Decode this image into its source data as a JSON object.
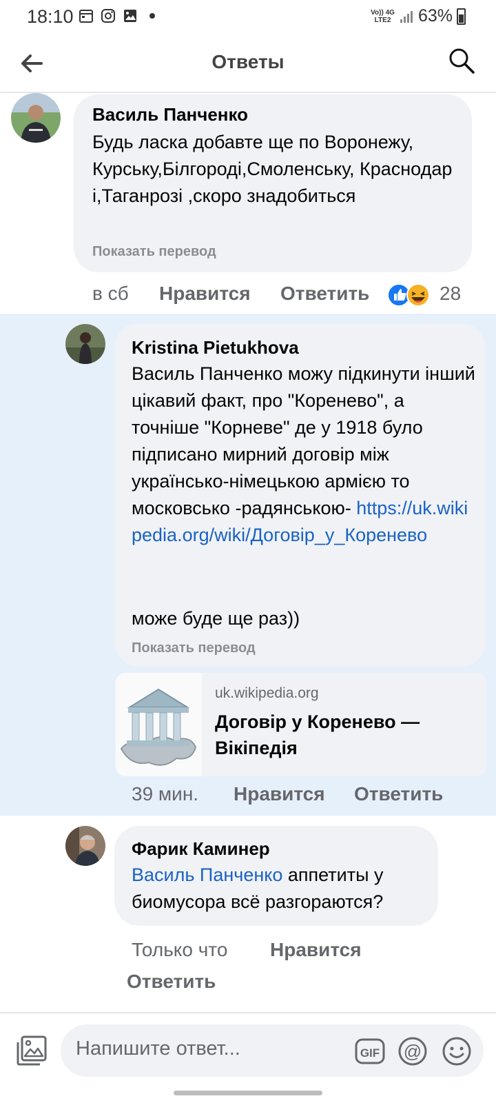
{
  "status_bar": {
    "time": "18:10",
    "network_top": "Vo)) 4G",
    "network_bottom": "LTE2",
    "battery": "63%"
  },
  "header": {
    "title": "Ответы",
    "back_icon": "arrow-left-icon",
    "search_icon": "search-icon"
  },
  "comments": [
    {
      "author": "Василь Панченко",
      "text": "Будь ласка добавте ще по Воронежу, Курську,Білгороді,Смоленську, Краснодар і,Таганрозі ,скоро знадобиться",
      "translate": "Показать перевод",
      "time": "в сб",
      "like": "Нравится",
      "reply": "Ответить",
      "reactions_count": "28",
      "reaction_icons": [
        "like-icon",
        "haha-icon"
      ]
    },
    {
      "author": "Kristina Pietukhova",
      "text": "Василь Панченко можу підкинути інший цікавий факт, про \"Коренево\", а точніше \"Корневе\" де у 1918 було підписано мирний договір між українсько-німецькою армією то московсько -радянською- ",
      "link": "https://uk.wikipedia.org/wiki/Договір_у_Коренево",
      "text_after": "може буде ще раз))",
      "translate": "Показать перевод",
      "preview_domain": "uk.wikipedia.org",
      "preview_title": "Договір у Коренево — Вікіпедія",
      "time": "39 мин.",
      "like": "Нравится",
      "reply": "Ответить"
    },
    {
      "author": "Фарик Каминер",
      "mention": "Василь Панченко",
      "text": " аппетиты у биомусора всё разгораются?",
      "time": "Только что",
      "like": "Нравится",
      "reply": "Ответить"
    }
  ],
  "composer": {
    "placeholder": "Напишите ответ...",
    "gif_label": "GIF",
    "at_label": "@"
  },
  "colors": {
    "link": "#1b62c4",
    "highlight": "#e6f0fb",
    "bubble": "#f0f2f5",
    "like_blue": "#1877f2"
  }
}
